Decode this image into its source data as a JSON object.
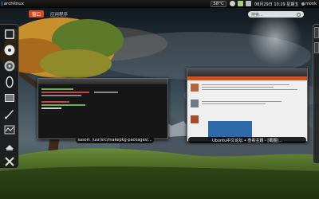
{
  "topbar": {
    "activities_label": "archlinux",
    "temperature": "58°C",
    "clock": "08月29日 10:29 星期五",
    "user": "monk"
  },
  "overview": {
    "tabs": [
      {
        "label": "窗口",
        "active": true
      },
      {
        "label": "应用程序",
        "active": false
      }
    ],
    "search_placeholder": "搜索..."
  },
  "dash": {
    "items": [
      {
        "name": "terminal-icon"
      },
      {
        "name": "disc-icon"
      },
      {
        "name": "audio-icon"
      },
      {
        "name": "text-editor-icon"
      },
      {
        "name": "image-viewer-icon"
      },
      {
        "name": "brush-icon"
      },
      {
        "name": "system-monitor-icon"
      },
      {
        "name": "files-icon"
      },
      {
        "name": "settings-icon"
      }
    ]
  },
  "windows": {
    "terminal_caption": "sasori: /usr/src/makepkg-packages/...",
    "browser_caption": "Ubuntu中文论坛 • 查看主题 - [截图]..."
  },
  "colors": {
    "accent": "#d64b21",
    "panel": "#0c0c0c"
  }
}
